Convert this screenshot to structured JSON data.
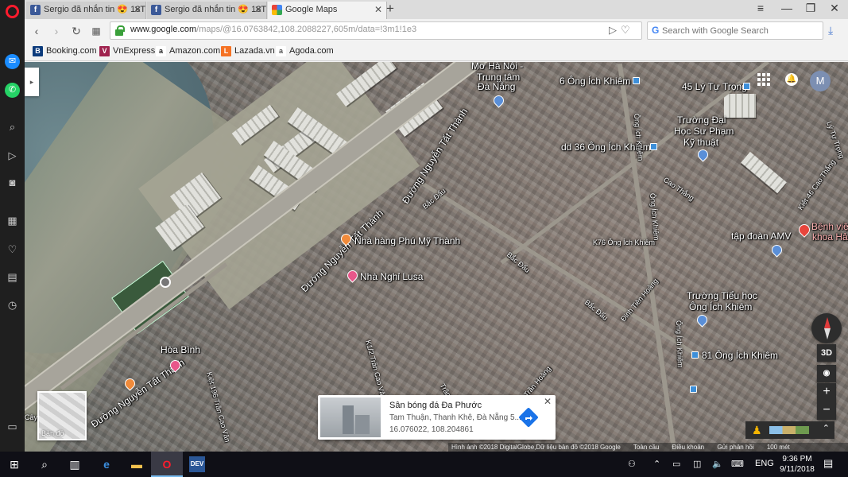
{
  "browser": {
    "tabs": [
      {
        "title": "Sergio đã nhắn tin 😍 18T",
        "favicon": "facebook-icon"
      },
      {
        "title": "Sergio đã nhắn tin 😍 18T",
        "favicon": "facebook-icon"
      },
      {
        "title": "Google Maps",
        "favicon": "google-maps-icon",
        "active": true
      }
    ],
    "url_host": "www.google.com",
    "url_path": "/maps/@16.0763842,108.2088227,605m/data=!3m1!1e3",
    "search_placeholder": "Search with Google Search",
    "bookmarks": [
      {
        "label": "Booking.com",
        "icon": "B",
        "color": "#0c3b7c"
      },
      {
        "label": "VnExpress",
        "icon": "V",
        "color": "#9f224e"
      },
      {
        "label": "Amazon.com",
        "icon": "a",
        "color": "#222222"
      },
      {
        "label": "Lazada.vn",
        "icon": "L",
        "color": "#f57224"
      },
      {
        "label": "Agoda.com",
        "icon": "a",
        "color": "#555555"
      }
    ]
  },
  "map": {
    "labels": {
      "mo_ha_noi": "Mơ Hà Nội -",
      "trung_tam": "Trung tâm",
      "da_nang": "Đà Nẵng",
      "ich_khiem_6": "6 Ông Ích Khiêm",
      "ly_tu_trong_45": "45 Lý Tự Trọng",
      "truong_dai": "Trường Đại",
      "hoc_su_pham": "Học Sư Phạm",
      "ky_thuat": "Kỹ thuật",
      "ich_khiem_36": "dd 36 Ông Ích Khiêm",
      "nguyen_tat_thanh_1": "Đường Nguyễn Tất Thành",
      "nguyen_tat_thanh_2": "Đường Nguyễn Tất Thành",
      "nguyen_tat_thanh_3": "Đường Nguyễn Tất Thành",
      "bac_dau_1": "Bắc Đẩu",
      "bac_dau_2": "Bắc Đẩu",
      "bac_dau_3": "Bắc Đẩu",
      "nha_hang": "Nhà hàng Phú Mỹ Thành",
      "nha_nghi": "Nhà Nghỉ Lusa",
      "k76": "K76 Ông Ích Khiêm",
      "ong_ich_khiem_v1": "Ông Ích Khiêm",
      "ong_ich_khiem_v2": "Ông Ích Khiêm",
      "ong_ich_khiem_v3": "Ông Ích Khiêm",
      "cao_thang": "Cao Thắng",
      "tap_doan": "tập đoàn AMV",
      "benh_vien": "Bệnh viện",
      "khoa_ha": "khoa Hả",
      "dinh_tien_hoang": "Đinh Tiên Hoàng",
      "truong_tieu_hoc": "Trường Tiểu học",
      "ong_ich_khiem_school": "Ông Ích Khiêm",
      "ich_khiem_81": "81 Ông Ích Khiêm",
      "hoa_binh": "Hòa Bình",
      "k1_tran_cao_van": "K1/2 Trần Cao Vân",
      "k196_tran_cao_van": "Kiệt 196 Trần Cao Vân",
      "tran_cao_van": "Trần Cao Vân",
      "tran_hoang": "Trần Hoàng",
      "ly_tu_trong_side": "Lý Tự Trọng",
      "kiet_lo": "Kiệt 46 Cao Thắng",
      "cay": "Cây"
    },
    "place_card": {
      "name": "Sân bóng đá Đa Phước",
      "address": "Tam Thuận, Thanh Khê, Đà Nẵng 5...",
      "coords": "16.076022, 108.204861"
    },
    "minimap_label": "Bản đồ",
    "avatar_initial": "M",
    "view_3d": "3D",
    "attribution": [
      "Hình ảnh ©2018 DigitalGlobe,Dữ liệu bản đồ ©2018 Google",
      "Toàn cầu",
      "Điều khoản",
      "Gửi phản hồi",
      "100 mét"
    ]
  },
  "taskbar": {
    "language": "ENG",
    "time": "9:36 PM",
    "date": "9/11/2018"
  }
}
